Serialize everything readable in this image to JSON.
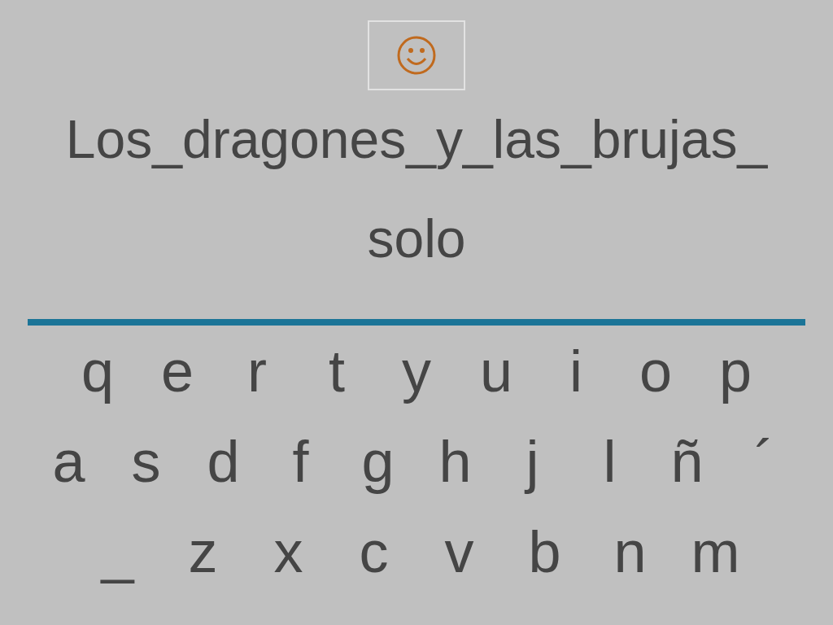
{
  "phrase": "Los_dragones_y_las_brujas_",
  "answer": "solo",
  "keyboard": [
    [
      "q",
      "e",
      "r",
      "t",
      "y",
      "u",
      "i",
      "o",
      "p"
    ],
    [
      "a",
      "s",
      "d",
      "f",
      "g",
      "h",
      "j",
      "l",
      "ñ",
      "´"
    ],
    [
      "_",
      "z",
      "x",
      "c",
      "v",
      "b",
      "n",
      "m"
    ]
  ]
}
